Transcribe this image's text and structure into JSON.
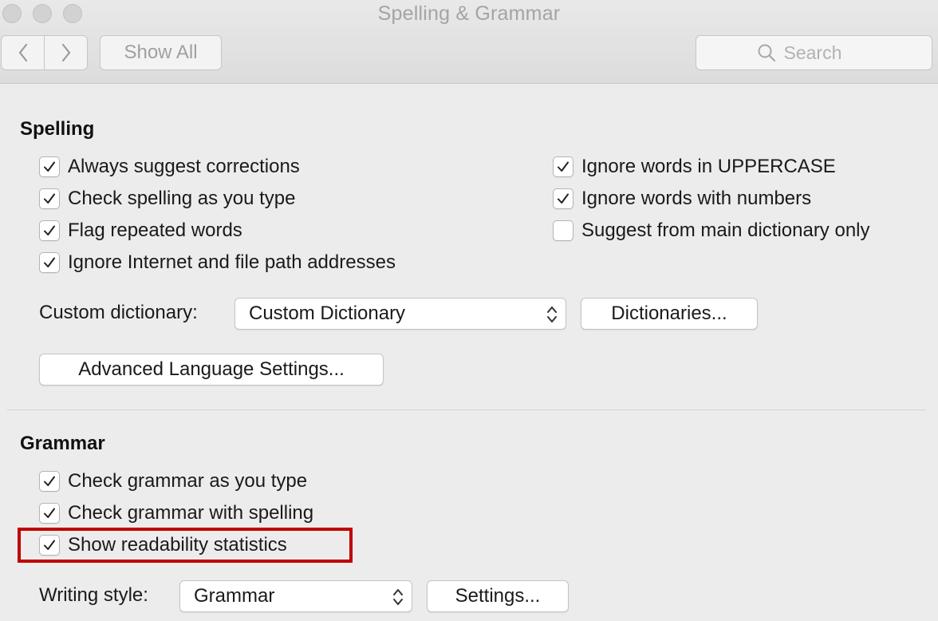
{
  "window": {
    "title": "Spelling & Grammar"
  },
  "toolbar": {
    "show_all_label": "Show All",
    "search_placeholder": "Search",
    "back_icon": "chevron-left-icon",
    "forward_icon": "chevron-right-icon"
  },
  "spelling": {
    "title": "Spelling",
    "options_left": [
      {
        "label": "Always suggest corrections",
        "checked": true
      },
      {
        "label": "Check spelling as you type",
        "checked": true
      },
      {
        "label": "Flag repeated words",
        "checked": true
      },
      {
        "label": "Ignore Internet and file path addresses",
        "checked": true
      }
    ],
    "options_right": [
      {
        "label": "Ignore words in UPPERCASE",
        "checked": true
      },
      {
        "label": "Ignore words with numbers",
        "checked": true
      },
      {
        "label": "Suggest from main dictionary only",
        "checked": false
      }
    ],
    "custom_dictionary_label": "Custom dictionary:",
    "custom_dictionary_value": "Custom Dictionary",
    "dictionaries_button": "Dictionaries...",
    "advanced_button": "Advanced Language Settings..."
  },
  "grammar": {
    "title": "Grammar",
    "options": [
      {
        "label": "Check grammar as you type",
        "checked": true
      },
      {
        "label": "Check grammar with spelling",
        "checked": true
      },
      {
        "label": "Show readability statistics",
        "checked": true,
        "highlighted": true
      }
    ],
    "writing_style_label": "Writing style:",
    "writing_style_value": "Grammar",
    "settings_button": "Settings..."
  },
  "colors": {
    "highlight": "#c00000",
    "background": "#ececec"
  }
}
